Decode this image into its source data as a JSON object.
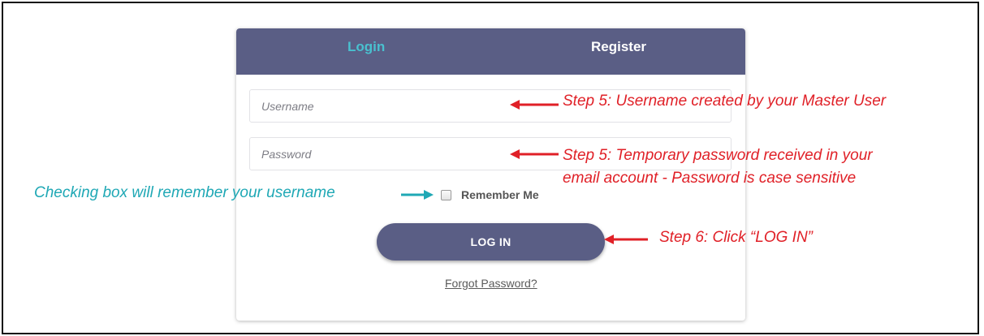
{
  "tabs": {
    "login": "Login",
    "register": "Register"
  },
  "form": {
    "username_placeholder": "Username",
    "password_placeholder": "Password",
    "remember_label": "Remember Me",
    "login_button": "LOG IN",
    "forgot_link": "Forgot Password?"
  },
  "annotations": {
    "username_step": "Step 5: Username created by your Master User",
    "password_step_line1": "Step 5: Temporary password received in your",
    "password_step_line2": "email account - Password is case sensitive",
    "remember_note": "Checking box will remember your username",
    "login_step": "Step 6: Click “LOG IN”"
  },
  "colors": {
    "tab_bar": "#5a5e85",
    "active_tab": "#49c0cf",
    "annotation_red": "#e02027",
    "annotation_teal": "#1fa8b5"
  },
  "icons": {
    "arrow_left": "red-left-arrow-icon",
    "arrow_right": "teal-right-arrow-icon"
  }
}
